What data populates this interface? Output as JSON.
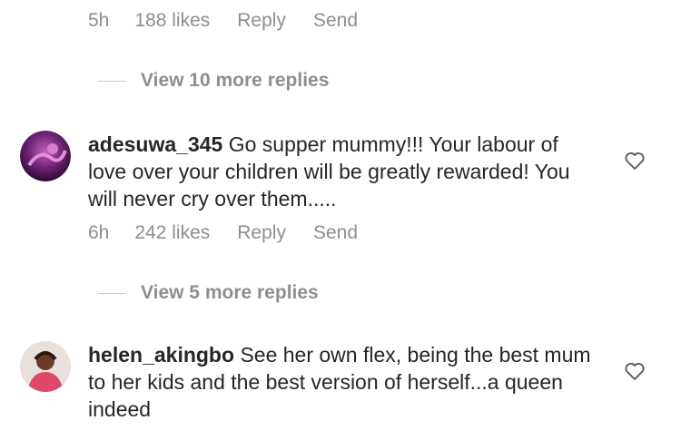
{
  "top_meta": {
    "time": "5h",
    "likes": "188 likes",
    "reply": "Reply",
    "send": "Send"
  },
  "replies_1": {
    "label": "View 10 more replies"
  },
  "comments": [
    {
      "username": "adesuwa_345",
      "text": "Go supper mummy!!! Your labour of love over your children will be greatly rewarded! You will never cry over them.....",
      "time": "6h",
      "likes": "242 likes",
      "reply": "Reply",
      "send": "Send"
    },
    {
      "username": "helen_akingbo",
      "text": "See her own flex, being the best mum to her kids and the best version of herself...a queen indeed"
    }
  ],
  "replies_2": {
    "label": "View 5 more replies"
  },
  "colors": {
    "text": "#262626",
    "muted": "#8e8e8e",
    "divider": "#c7c7c7"
  },
  "icons": {
    "like": "heart-outline-icon"
  }
}
